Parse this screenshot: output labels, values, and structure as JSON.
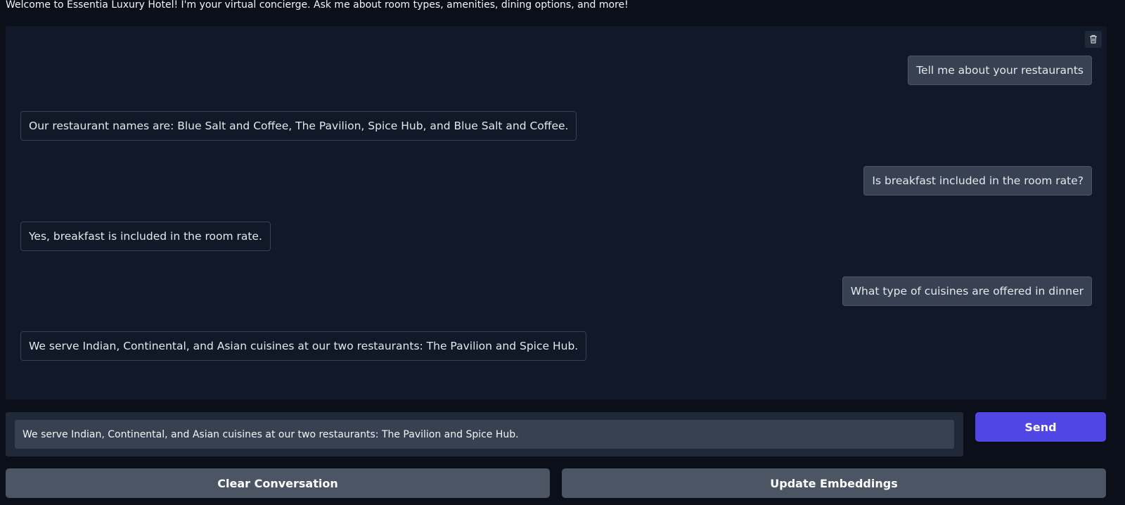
{
  "intro_text": "Welcome to Essentia Luxury Hotel! I'm your virtual concierge. Ask me about room types, amenities, dining options, and more!",
  "chat": {
    "clear_icon": "trash-icon",
    "messages": [
      {
        "role": "user",
        "text": "Tell me about your restaurants"
      },
      {
        "role": "bot",
        "text": "Our restaurant names are: Blue Salt and Coffee, The Pavilion, Spice Hub, and Blue Salt and Coffee."
      },
      {
        "role": "user",
        "text": "Is breakfast included in the room rate?"
      },
      {
        "role": "bot",
        "text": "Yes, breakfast is included in the room rate."
      },
      {
        "role": "user",
        "text": "What type of cuisines are offered in dinner"
      },
      {
        "role": "bot",
        "text": "We serve Indian, Continental, and Asian cuisines at our two restaurants: The Pavilion and Spice Hub."
      }
    ]
  },
  "input": {
    "value": "We serve Indian, Continental, and Asian cuisines at our two restaurants: The Pavilion and Spice Hub."
  },
  "buttons": {
    "send": "Send",
    "clear": "Clear Conversation",
    "update": "Update Embeddings"
  },
  "colors": {
    "background": "#0b0f19",
    "panel": "#111827",
    "user_bubble": "#374151",
    "send_button": "#4f46e5",
    "secondary_button": "#4b5563"
  }
}
